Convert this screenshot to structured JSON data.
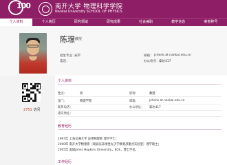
{
  "header": {
    "logo_text": "100",
    "brand_cn": "南开大学 物理科学学院",
    "brand_en": "Nankai University   SCHOOL OF PHYSICS"
  },
  "nav": {
    "items": [
      "个人资料",
      "个人简历",
      "研究领域",
      "研究成果",
      "社会兼职",
      "教学信息",
      "荣誉称号"
    ],
    "active_index": 0
  },
  "profile": {
    "name": "陈璟",
    "title": "教授",
    "fields_left": [
      {
        "label": "招生专业：",
        "value": "光学"
      },
      {
        "label": "电话：",
        "value": ""
      }
    ],
    "fields_right": [
      {
        "label": "邮箱：",
        "value": "jchenk at nankai.edu.cn"
      },
      {
        "label": "办公地点：",
        "value": "泰达417"
      }
    ]
  },
  "sidebar": {
    "visit_count": "2751",
    "visit_label": "访问"
  },
  "personal": {
    "section_title": "个人资料",
    "rows": [
      {
        "l1": "性别：",
        "v1": "男",
        "l2": "职称：",
        "v2": "教授"
      },
      {
        "l1": "部门：",
        "v1": "物理学院",
        "l2": "邮箱：",
        "v2": "jchenk at nankai.edu.cn"
      },
      {
        "l1": "联系电话：",
        "v1": "",
        "l2": "办公地址：",
        "v2": "泰达417"
      },
      {
        "l1": "通讯地址：",
        "v1": "",
        "l2": "",
        "v2": ""
      }
    ]
  },
  "education": {
    "section_title": "教育经历",
    "items": [
      "1997年 上海交通大学 应用物理系 理学学士；",
      "2000年 南开大学物理系（现弱光非线性光子学教育部重点实验室）理学硕士；",
      "2005年 美国Johns Hopkins University，ECE，博士学位。"
    ]
  },
  "work": {
    "section_title": "工作经历"
  },
  "colors": {
    "brand": "#8e1f66",
    "visit_number": "#c0392b"
  }
}
